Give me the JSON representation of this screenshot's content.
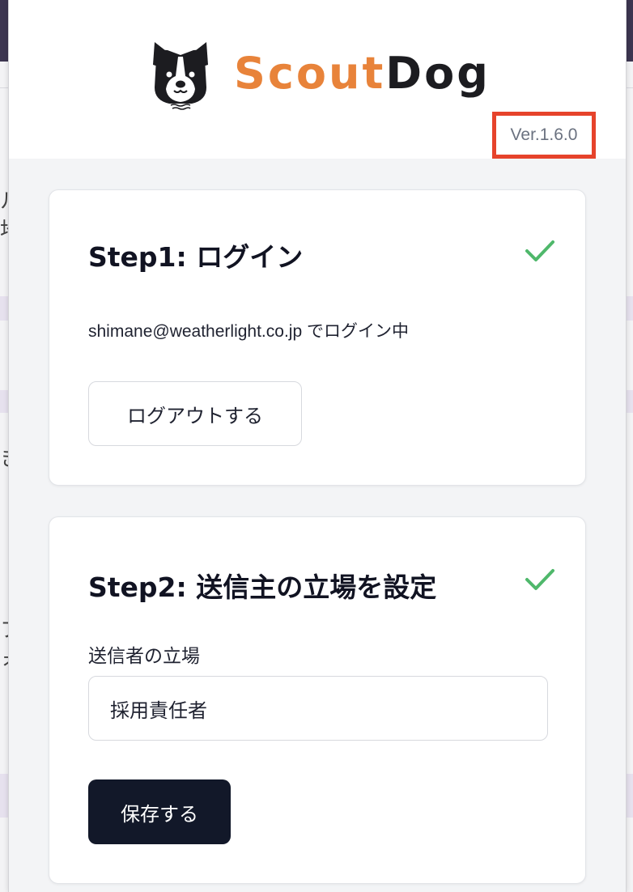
{
  "app": {
    "logo_part1": "Scout",
    "logo_part2": "Dog",
    "version": "Ver.1.6.0"
  },
  "step1": {
    "title": "Step1: ログイン",
    "status_text": "shimane@weatherlight.co.jp でログイン中",
    "logout_label": "ログアウトする",
    "completed": true
  },
  "step2": {
    "title": "Step2: 送信主の立場を設定",
    "field_label": "送信者の立場",
    "field_value": "採用責任者",
    "save_label": "保存する",
    "completed": true
  },
  "background_page": {
    "side_glyphs": [
      "ル",
      "地",
      "き",
      "フ",
      "ォ"
    ]
  },
  "colors": {
    "brand_orange": "#e8833a",
    "brand_dark": "#1c1c20",
    "check_green": "#4fb86b",
    "primary_button": "#121829",
    "highlight_box": "#e6432b"
  }
}
